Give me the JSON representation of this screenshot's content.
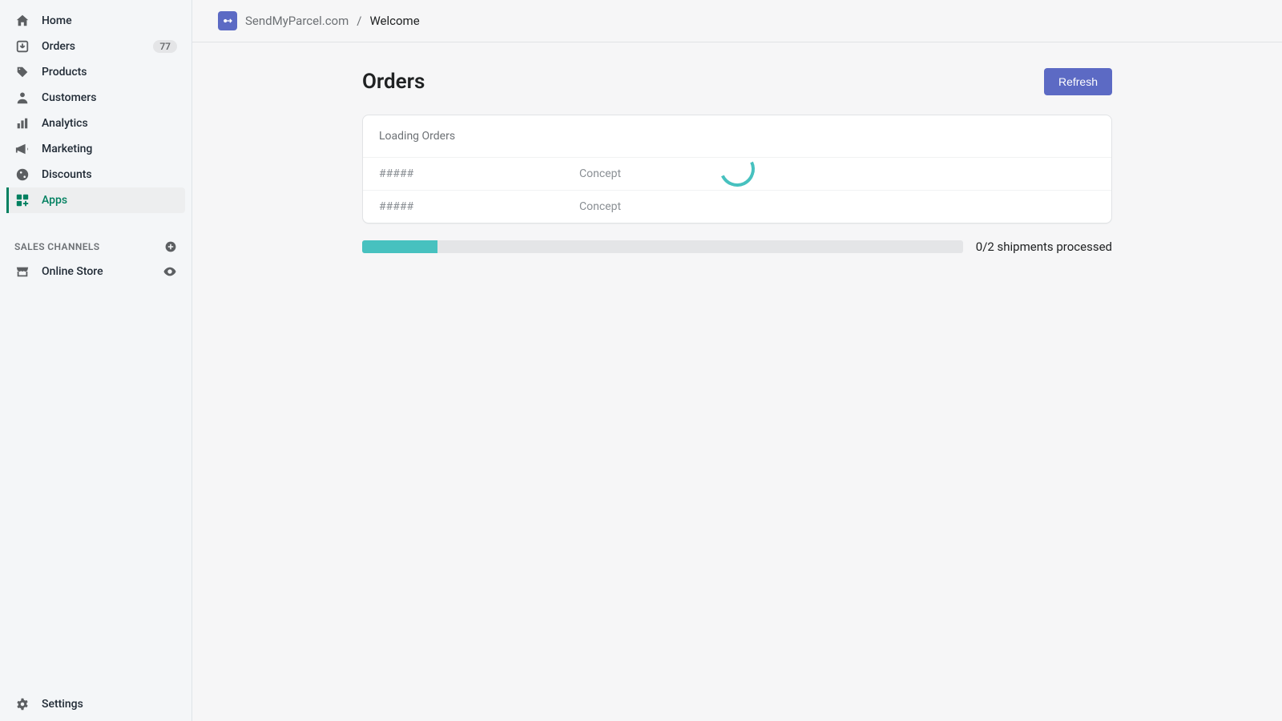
{
  "sidebar": {
    "items": [
      {
        "label": "Home",
        "icon": "home-icon",
        "badge": null,
        "active": false
      },
      {
        "label": "Orders",
        "icon": "orders-icon",
        "badge": "77",
        "active": false
      },
      {
        "label": "Products",
        "icon": "tag-icon",
        "badge": null,
        "active": false
      },
      {
        "label": "Customers",
        "icon": "person-icon",
        "badge": null,
        "active": false
      },
      {
        "label": "Analytics",
        "icon": "bars-icon",
        "badge": null,
        "active": false
      },
      {
        "label": "Marketing",
        "icon": "megaphone-icon",
        "badge": null,
        "active": false
      },
      {
        "label": "Discounts",
        "icon": "percent-icon",
        "badge": null,
        "active": false
      },
      {
        "label": "Apps",
        "icon": "apps-icon",
        "badge": null,
        "active": true
      }
    ],
    "section_title": "SALES CHANNELS",
    "channels": [
      {
        "label": "Online Store",
        "icon": "store-icon"
      }
    ],
    "settings_label": "Settings"
  },
  "breadcrumb": {
    "app": "SendMyParcel.com",
    "sep": "/",
    "page": "Welcome"
  },
  "main": {
    "title": "Orders",
    "refresh_label": "Refresh",
    "loading_label": "Loading Orders",
    "rows": [
      {
        "id": "#####",
        "status": "Concept"
      },
      {
        "id": "#####",
        "status": "Concept"
      }
    ],
    "progress": {
      "label": "0/2 shipments processed",
      "percent": 12.5
    }
  },
  "colors": {
    "accent_green": "#008060",
    "accent_indigo": "#5c6ac4",
    "accent_teal": "#47c1bf"
  }
}
